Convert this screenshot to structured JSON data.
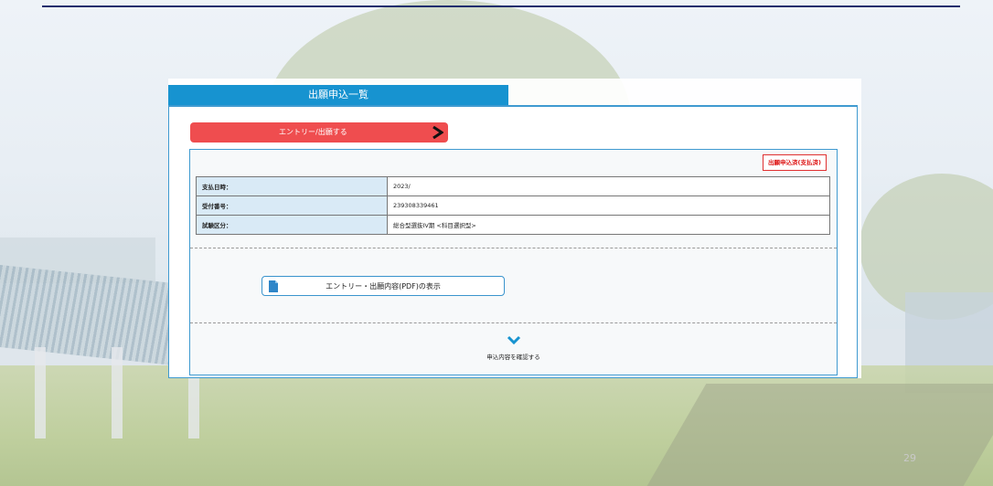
{
  "slide": {
    "page_number": "29"
  },
  "tab": {
    "title": "出願申込一覧"
  },
  "entry_button": {
    "label": "エントリー/出願する"
  },
  "status_badge": {
    "label": "出願申込済(支払済)"
  },
  "info_rows": [
    {
      "label": "支払日時：",
      "value": "2023/"
    },
    {
      "label": "受付番号：",
      "value": "239308339461"
    },
    {
      "label": "試験区分：",
      "value": "総合型選抜IV期 <科目選択型>"
    }
  ],
  "pdf_button": {
    "label": "エントリー・出願内容(PDF)の表示"
  },
  "confirm": {
    "label": "申込内容を確認する"
  },
  "colors": {
    "tab": "#1793d0",
    "entry_button": "#ef4d4f",
    "border": "#3f9ad0",
    "badge": "#e03030"
  },
  "icons": {
    "entry": "chevron-right-icon",
    "pdf": "document-icon",
    "confirm": "chevron-down-icon"
  }
}
